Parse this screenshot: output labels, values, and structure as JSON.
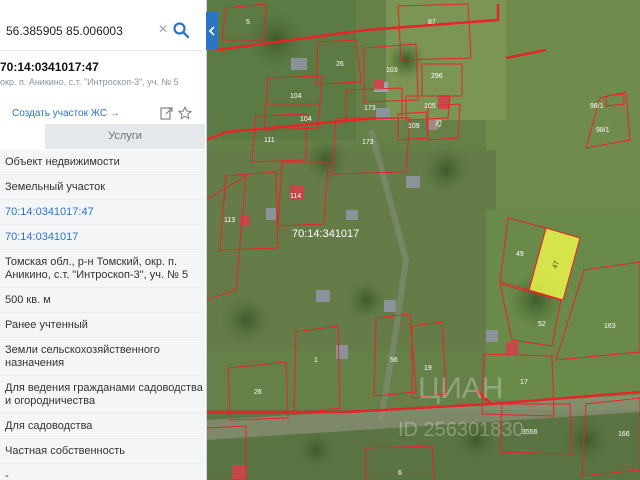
{
  "search": {
    "value": "56.385905 85.006003"
  },
  "parcel": {
    "title": "70:14:0341017:47",
    "address": "окр. п. Аникино, с.т. \"Интроскоп-3\", уч. № 5"
  },
  "actions": {
    "create_label": "Создать участок ЖС →"
  },
  "tabs": {
    "services": "Услуги"
  },
  "info_rows": [
    {
      "lines": [
        "Объект недвижимости"
      ],
      "link": false
    },
    {
      "lines": [
        "Земельный участок"
      ],
      "link": false
    },
    {
      "lines": [
        "70:14:0341017:47"
      ],
      "link": true
    },
    {
      "lines": [
        "70:14:0341017"
      ],
      "link": true
    },
    {
      "lines": [
        "Томская обл., р-н Томский, окр. п.",
        "Аникино, с.т. \"Интроскоп-3\", уч. № 5"
      ],
      "link": false
    },
    {
      "lines": [
        "500 кв. м"
      ],
      "link": false
    },
    {
      "lines": [
        "Ранее учтенный"
      ],
      "link": false
    },
    {
      "lines": [
        "Земли сельскохозяйственного",
        "назначения"
      ],
      "link": false
    },
    {
      "lines": [
        "Для ведения гражданами садоводства",
        "и огородничества"
      ],
      "link": false
    },
    {
      "lines": [
        "Для садоводства"
      ],
      "link": false
    },
    {
      "lines": [
        "Частная собственность"
      ],
      "link": false
    },
    {
      "lines": [
        "-"
      ],
      "link": false
    }
  ],
  "map": {
    "quarter_label": "70:14:341017",
    "selected_plot": "47",
    "watermark": "ЦИАН",
    "watermark_id": "ID 256301830",
    "plot_numbers": [
      "5",
      "87",
      "26",
      "103",
      "296",
      "104",
      "104",
      "173",
      "109",
      "173",
      "109",
      "25",
      "111",
      "114",
      "113",
      "49",
      "52",
      "163",
      "98/1",
      "98/1",
      "1",
      "56",
      "19",
      "17",
      "26",
      "3556",
      "166",
      "6"
    ],
    "colors": {
      "boundary": "#e8232a",
      "selected_fill": "#e7f34a",
      "panel_accent": "#2d74c4"
    }
  }
}
